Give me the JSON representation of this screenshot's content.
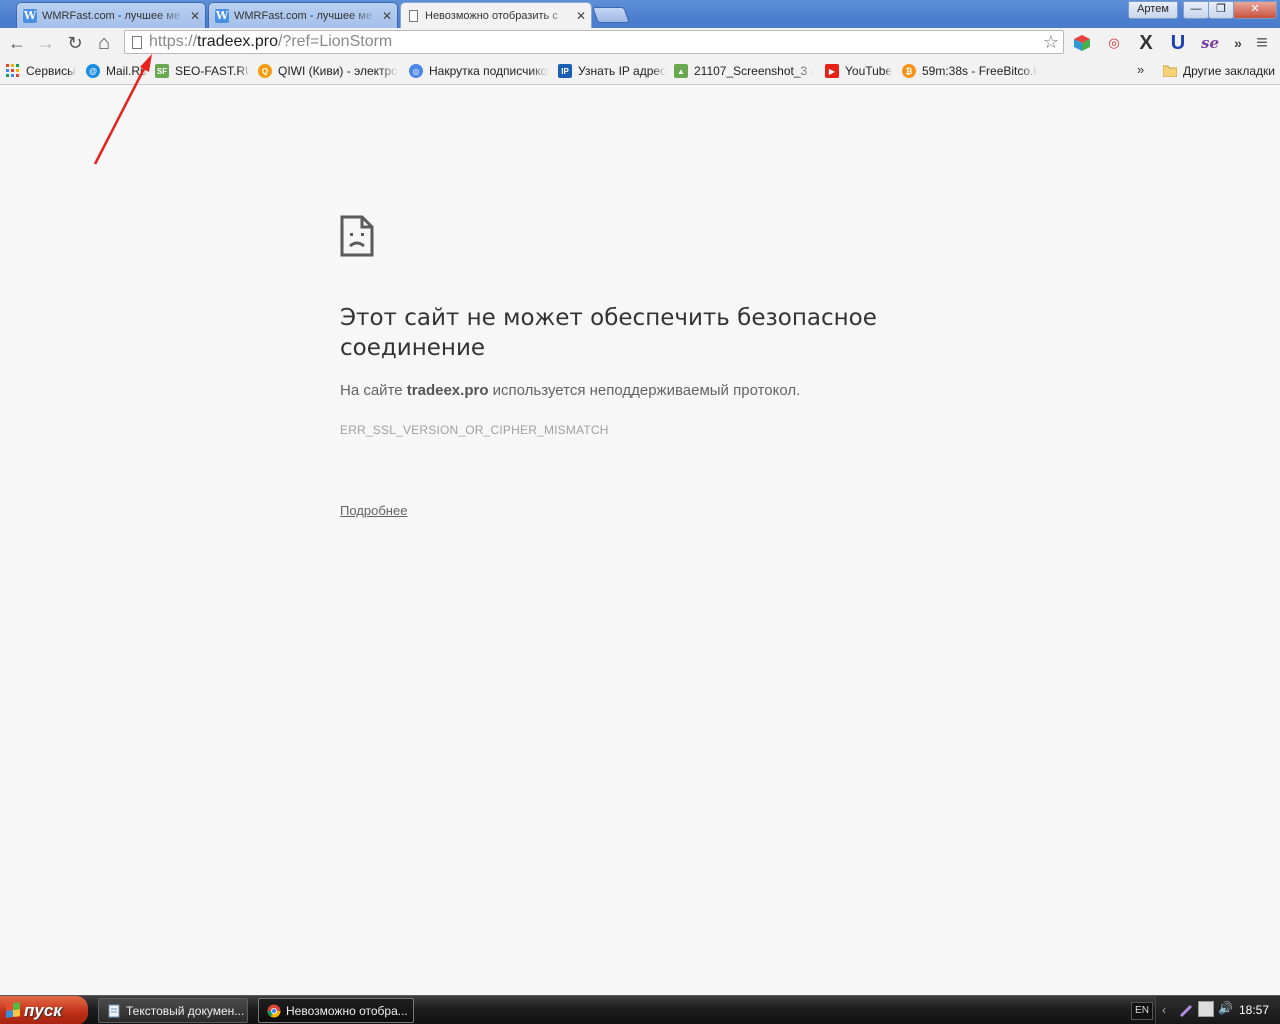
{
  "browser": {
    "tabs": [
      {
        "title": "WMRFast.com - лучшее ме",
        "favicon": "w-icon",
        "active": false
      },
      {
        "title": "WMRFast.com - лучшее ме",
        "favicon": "w-icon",
        "active": false
      },
      {
        "title": "Невозможно отобразить с",
        "favicon": "page-icon",
        "active": true
      }
    ],
    "user_name": "Артем",
    "window_controls": {
      "minimize": "—",
      "restore": "❐",
      "close": "✕"
    }
  },
  "toolbar": {
    "url_scheme": "https://",
    "url_host": "tradeex.pro",
    "url_rest": "/?ref=LionStorm",
    "back_icon": "←",
    "forward_icon": "→",
    "reload_icon": "↻",
    "home_icon": "⌂",
    "star_icon": "☆",
    "menu_icon": "≡",
    "overflow_icon": "»",
    "extensions": [
      {
        "name": "cube-extension-icon",
        "glyph": "■",
        "color": "#e8423b"
      },
      {
        "name": "swirl-extension-icon",
        "glyph": "◎",
        "color": "#d32f2f"
      },
      {
        "name": "x-extension-icon",
        "glyph": "X",
        "color": "#333333"
      },
      {
        "name": "u-extension-icon",
        "glyph": "U",
        "color": "#1e3fb0"
      },
      {
        "name": "se-extension-icon",
        "glyph": "se",
        "color": "#7b3fa0"
      }
    ]
  },
  "bookmarks": {
    "items": [
      {
        "label": "Сервисы",
        "icon": "apps-grid-icon",
        "color": "#e34234"
      },
      {
        "label": "Mail.Ru",
        "icon": "mailru-icon",
        "color": "#168de2"
      },
      {
        "label": "SEO-FAST.RU",
        "icon": "seofast-icon",
        "color": "#6aa84f"
      },
      {
        "label": "QIWI (Киви) - электрон",
        "icon": "qiwi-icon",
        "color": "#f39c12"
      },
      {
        "label": "Накрутка подписчиков",
        "icon": "spiral-icon",
        "color": "#4a86e8"
      },
      {
        "label": "Узнать IP адрес",
        "icon": "ip-icon",
        "color": "#1a5fb4"
      },
      {
        "label": "21107_Screenshot_3 - ",
        "icon": "image-icon",
        "color": "#6aa84f"
      },
      {
        "label": "YouTube",
        "icon": "youtube-icon",
        "color": "#e62117"
      },
      {
        "label": "59m:38s - FreeBitco.in - ",
        "icon": "bitcoin-icon",
        "color": "#f7931a"
      }
    ],
    "overflow": "»",
    "other_label": "Другие закладки"
  },
  "error_page": {
    "title": "Этот сайт не может обеспечить безопасное соединение",
    "desc_prefix": "На сайте ",
    "desc_host": "tradeex.pro",
    "desc_suffix": " используется неподдерживаемый протокол.",
    "error_code": "ERR_SSL_VERSION_OR_CIPHER_MISMATCH",
    "details_link": "Подробнее"
  },
  "taskbar": {
    "start_label": "пуск",
    "tasks": [
      {
        "label": "Текстовый докумен...",
        "active": false
      },
      {
        "label": "Невозможно отобра...",
        "active": true
      }
    ],
    "language": "EN",
    "clock": "18:57"
  }
}
